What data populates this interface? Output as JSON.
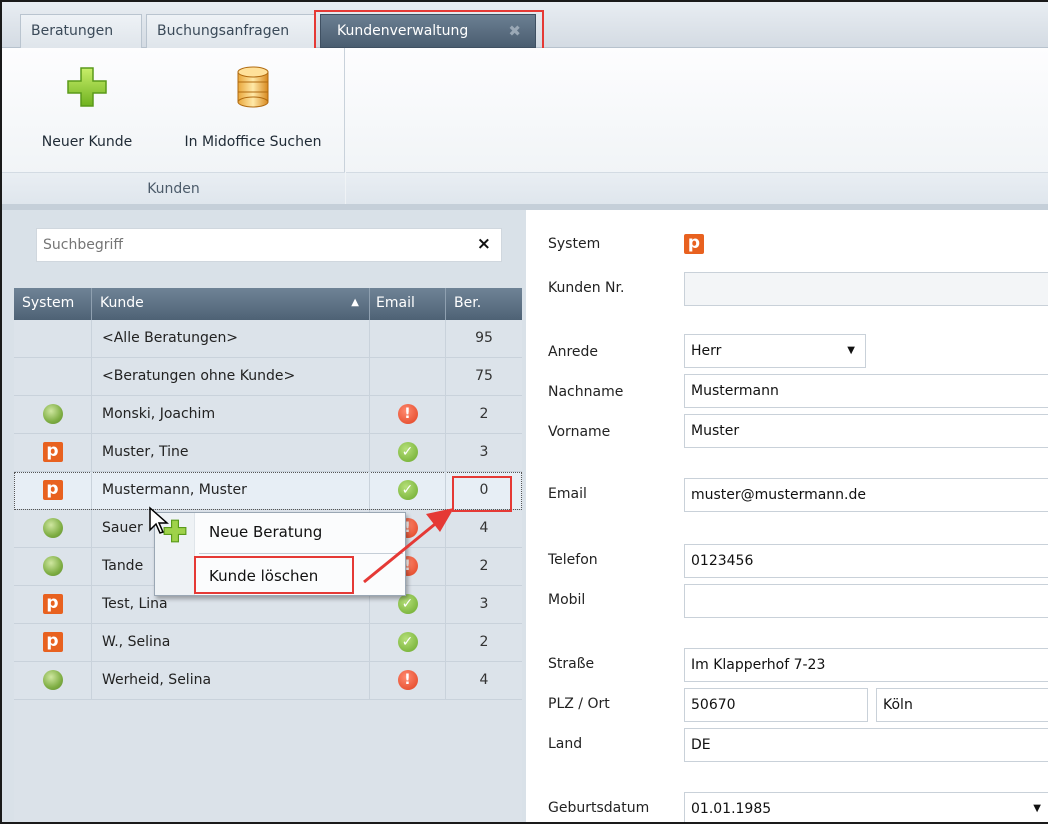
{
  "tabs": [
    {
      "label": "Beratungen"
    },
    {
      "label": "Buchungsanfragen"
    },
    {
      "label": "Kundenverwaltung",
      "active": true,
      "close_icon": "close-icon"
    }
  ],
  "ribbon": {
    "new_customer_label": "Neuer Kunde",
    "midoffice_label": "In Midoffice Suchen",
    "group_label": "Kunden"
  },
  "search": {
    "placeholder": "Suchbegriff",
    "value": "",
    "clear_label": "×"
  },
  "grid": {
    "headers": {
      "system": "System",
      "kunde": "Kunde",
      "email": "Email",
      "ber": "Ber."
    },
    "sort": "ascending",
    "rows": [
      {
        "system": "",
        "kunde": "<Alle Beratungen>",
        "email": "",
        "ber": "95"
      },
      {
        "system": "",
        "kunde": "<Beratungen ohne Kunde>",
        "email": "",
        "ber": "75"
      },
      {
        "system": "globe",
        "kunde": "Monski, Joachim",
        "email": "warn",
        "ber": "2"
      },
      {
        "system": "p",
        "kunde": "Muster, Tine",
        "email": "ok",
        "ber": "3"
      },
      {
        "system": "p",
        "kunde": "Mustermann, Muster",
        "email": "ok",
        "ber": "0",
        "selected": true
      },
      {
        "system": "globe",
        "kunde": "Sauer",
        "email": "warn",
        "ber": "4"
      },
      {
        "system": "globe",
        "kunde": "Tande",
        "email": "warn",
        "ber": "2"
      },
      {
        "system": "p",
        "kunde": "Test, Lina",
        "email": "ok",
        "ber": "3"
      },
      {
        "system": "p",
        "kunde": "W., Selina",
        "email": "ok",
        "ber": "2"
      },
      {
        "system": "globe",
        "kunde": "Werheid, Selina",
        "email": "warn",
        "ber": "4"
      }
    ]
  },
  "context_menu": {
    "items": [
      {
        "label": "Neue Beratung",
        "icon": "plus-icon"
      },
      {
        "label": "Kunde löschen"
      }
    ]
  },
  "system_icon_letter": "p",
  "form": {
    "system_label": "System",
    "kunden_nr_label": "Kunden Nr.",
    "kunden_nr": "",
    "anrede_label": "Anrede",
    "anrede": "Herr",
    "nachname_label": "Nachname",
    "nachname": "Mustermann",
    "vorname_label": "Vorname",
    "vorname": "Muster",
    "email_label": "Email",
    "email": "muster@mustermann.de",
    "telefon_label": "Telefon",
    "telefon": "0123456",
    "mobil_label": "Mobil",
    "mobil": "",
    "strasse_label": "Straße",
    "strasse": "Im Klapperhof 7-23",
    "plzort_label": "PLZ / Ort",
    "plz": "50670",
    "ort": "Köln",
    "land_label": "Land",
    "land": "DE",
    "geburtsdatum_label": "Geburtsdatum",
    "geburtsdatum": "01.01.1985"
  },
  "colors": {
    "highlight": "#e53935",
    "accent_orange": "#e8611f",
    "header": "#5a6e82"
  }
}
